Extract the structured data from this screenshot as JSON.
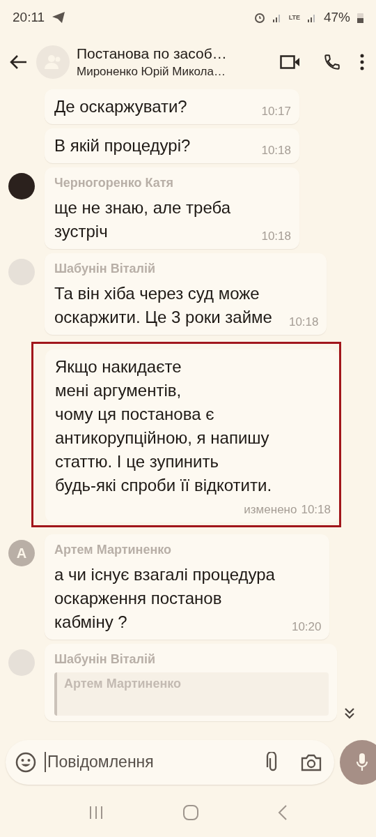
{
  "status_bar": {
    "time": "20:11",
    "network": "LTE",
    "battery": "47%"
  },
  "header": {
    "title": "Постанова по засоб…",
    "subtitle": "Мироненко Юрій Микола…"
  },
  "messages": [
    {
      "kind": "plain",
      "text": "Де оскаржувати?",
      "time": "10:17",
      "highlighted": false
    },
    {
      "kind": "plain",
      "text": "В якій процедурі?",
      "time": "10:18",
      "highlighted": false
    },
    {
      "kind": "photo",
      "sender": "Черногоренко Катя",
      "text": "ще не знаю, але треба\nзустріч",
      "time": "10:18",
      "highlighted": false
    },
    {
      "kind": "face",
      "sender": "Шабунін Віталій",
      "text": "Та він хіба через суд може\nоскаржити. Це 3 роки займе",
      "time": "10:18",
      "highlighted": false
    },
    {
      "kind": "plain",
      "text": "Якщо накидаєте\nмені аргументів,\nчому ця постанова є\nантикорупційною, я напишу\nстаттю. І це зупинить\nбудь-які спроби її відкотити.",
      "edited_label": "изменено",
      "time": "10:18",
      "highlighted": true
    },
    {
      "kind": "letter",
      "avatar_letter": "A",
      "sender": "Артем Мартиненко",
      "text": "а чи існує взагалі процедура\nоскарження постанов\nкабміну ?",
      "time": "10:20",
      "highlighted": false
    },
    {
      "kind": "face",
      "sender": "Шабунін Віталій",
      "quote": {
        "sender": "Артем Мартиненко"
      },
      "highlighted": false
    }
  ],
  "composer": {
    "placeholder": "Повідомлення"
  }
}
